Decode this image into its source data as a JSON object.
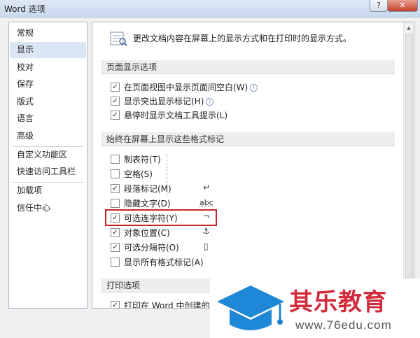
{
  "window": {
    "title": "Word 选项",
    "help": "?",
    "close": "✕"
  },
  "nav": {
    "items": [
      {
        "label": "常规"
      },
      {
        "label": "显示"
      },
      {
        "label": "校对"
      },
      {
        "label": "保存"
      },
      {
        "label": "版式"
      },
      {
        "label": "语言"
      },
      {
        "label": "高级"
      },
      {
        "label": "自定义功能区"
      },
      {
        "label": "快速访问工具栏"
      },
      {
        "label": "加载项"
      },
      {
        "label": "信任中心"
      }
    ],
    "selected": "显示"
  },
  "panel": {
    "header": "更改文档内容在屏幕上的显示方式和在打印时的显示方式。",
    "sections": {
      "page_display": "页面显示选项",
      "formatting_marks": "始终在屏幕上显示这些格式标记",
      "print": "打印选项"
    },
    "page_display_options": [
      {
        "label": "在页面视图中显示页面间空白(W)",
        "checked": true
      },
      {
        "label": "显示突出显示标记(H)",
        "checked": true
      },
      {
        "label": "悬停时显示文档工具提示(L)",
        "checked": true
      }
    ],
    "format_marks": [
      {
        "label": "制表符(T)",
        "checked": false,
        "mark": "→"
      },
      {
        "label": "空格(S)",
        "checked": false,
        "mark": "···"
      },
      {
        "label": "段落标记(M)",
        "checked": true,
        "mark": "↵"
      },
      {
        "label": "隐藏文字(D)",
        "checked": false,
        "mark": "abc"
      },
      {
        "label": "可选连字符(Y)",
        "checked": true,
        "mark": "¬"
      },
      {
        "label": "对象位置(C)",
        "checked": true,
        "mark": "⚓"
      },
      {
        "label": "可选分隔符(O)",
        "checked": true,
        "mark": "▯"
      },
      {
        "label": "显示所有格式标记(A)",
        "checked": false
      }
    ],
    "print_options": [
      {
        "label": "打印在 Word 中创建的图",
        "checked": true
      }
    ],
    "check_glyph": "✓"
  },
  "watermark": {
    "name": "其乐教育",
    "url": "www.76edu.com"
  },
  "colors": {
    "highlight": "#c1272d",
    "watermark_red": "#d22b3b",
    "watermark_blue": "#1e88d6"
  }
}
